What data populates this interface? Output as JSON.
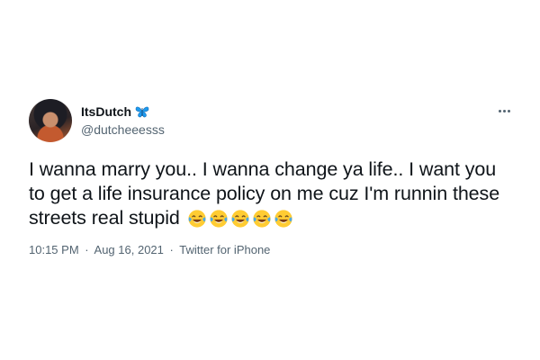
{
  "tweet": {
    "display_name": "ItsDutch",
    "handle": "@dutcheeesss",
    "text": "I wanna marry you.. I wanna change ya life.. I want you to get a life insurance policy on me cuz I'm runnin these streets real stupid",
    "emoji": "😂😂😂😂😂",
    "emoji_icon_name": "face-with-tears-of-joy-icon",
    "emoji_count": 5,
    "time": "10:15 PM",
    "date": "Aug 16, 2021",
    "separator": "·",
    "source": "Twitter for iPhone",
    "verified_icon_name": "butterfly-icon",
    "more_icon_name": "more-icon"
  },
  "colors": {
    "text_primary": "#0f1419",
    "text_secondary": "#536471",
    "butterfly": "#1d9bf0",
    "background": "#ffffff"
  }
}
